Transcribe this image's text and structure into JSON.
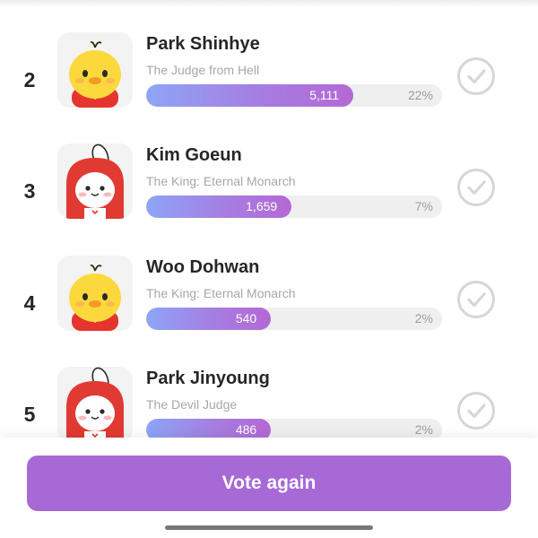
{
  "colors": {
    "accent": "#a769d6",
    "bar_gradient_start": "#8ea5f7",
    "bar_gradient_end": "#b468d6",
    "bar_track": "#efefef",
    "check_circle": "#d6d6d6"
  },
  "ranking": [
    {
      "rank": "2",
      "name": "Park Shinhye",
      "drama": "The Judge from Hell",
      "votes": "5,111",
      "percent": "22%",
      "share": 0.22,
      "avatar": "chick-character-icon"
    },
    {
      "rank": "3",
      "name": "Kim Goeun",
      "drama": "The King: Eternal Monarch",
      "votes": "1,659",
      "percent": "7%",
      "share": 0.07,
      "avatar": "bunny-character-icon"
    },
    {
      "rank": "4",
      "name": "Woo Dohwan",
      "drama": "The King: Eternal Monarch",
      "votes": "540",
      "percent": "2%",
      "share": 0.02,
      "avatar": "chick-character-icon"
    },
    {
      "rank": "5",
      "name": "Park Jinyoung",
      "drama": "The Devil Judge",
      "votes": "486",
      "percent": "2%",
      "share": 0.02,
      "avatar": "bunny-character-icon"
    }
  ],
  "footer": {
    "vote_again_label": "Vote again"
  }
}
